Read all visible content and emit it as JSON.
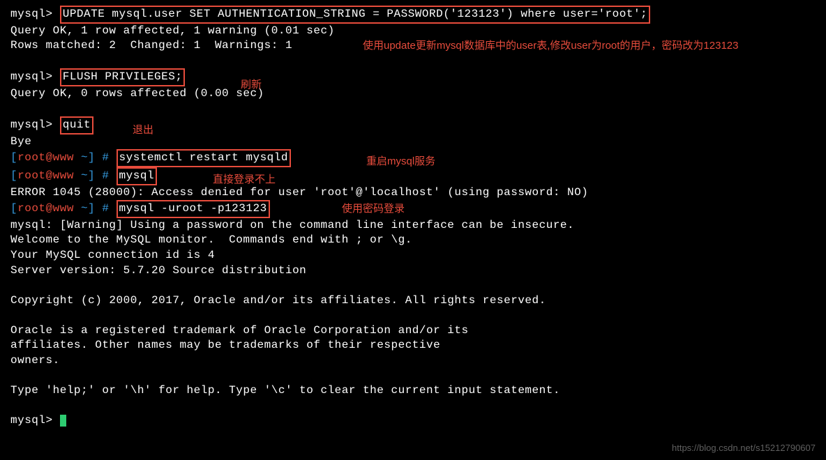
{
  "lines": {
    "l1_prompt": "mysql> ",
    "l1_cmd": "UPDATE mysql.user SET AUTHENTICATION_STRING = PASSWORD('123123') where user='root';",
    "l2": "Query OK, 1 row affected, 1 warning (0.01 sec)",
    "l3": "Rows matched: 2  Changed: 1  Warnings: 1",
    "l4": "",
    "l5_prompt": "mysql> ",
    "l5_cmd": "FLUSH PRIVILEGES;",
    "l6": "Query OK, 0 rows affected (0.00 sec)",
    "l7": "",
    "l8_prompt": "mysql> ",
    "l8_cmd": "quit",
    "l9": "Bye",
    "l10_open": "[",
    "l10_user": "root@www",
    "l10_path": " ~",
    "l10_close": "] # ",
    "l10_cmd": "systemctl restart mysqld",
    "l11_open": "[",
    "l11_user": "root@www",
    "l11_path": " ~",
    "l11_close": "] # ",
    "l11_cmd": "mysql",
    "l12": "ERROR 1045 (28000): Access denied for user 'root'@'localhost' (using password: NO)",
    "l13_open": "[",
    "l13_user": "root@www",
    "l13_path": " ~",
    "l13_close": "] # ",
    "l13_cmd": "mysql -uroot -p123123",
    "l14": "mysql: [Warning] Using a password on the command line interface can be insecure.",
    "l15": "Welcome to the MySQL monitor.  Commands end with ; or \\g.",
    "l16": "Your MySQL connection id is 4",
    "l17": "Server version: 5.7.20 Source distribution",
    "l18": "",
    "l19": "Copyright (c) 2000, 2017, Oracle and/or its affiliates. All rights reserved.",
    "l20": "",
    "l21": "Oracle is a registered trademark of Oracle Corporation and/or its",
    "l22": "affiliates. Other names may be trademarks of their respective",
    "l23": "owners.",
    "l24": "",
    "l25": "Type 'help;' or '\\h' for help. Type '\\c' to clear the current input statement.",
    "l26": "",
    "l27_prompt": "mysql> "
  },
  "annotations": {
    "a1": "使用update更新mysql数据库中的user表,修改user为root的用户，密码改为123123",
    "a2": "刷新",
    "a3": "退出",
    "a4": "重启mysql服务",
    "a5": "直接登录不上",
    "a6": "使用密码登录"
  },
  "watermark": "https://blog.csdn.net/s15212790607"
}
